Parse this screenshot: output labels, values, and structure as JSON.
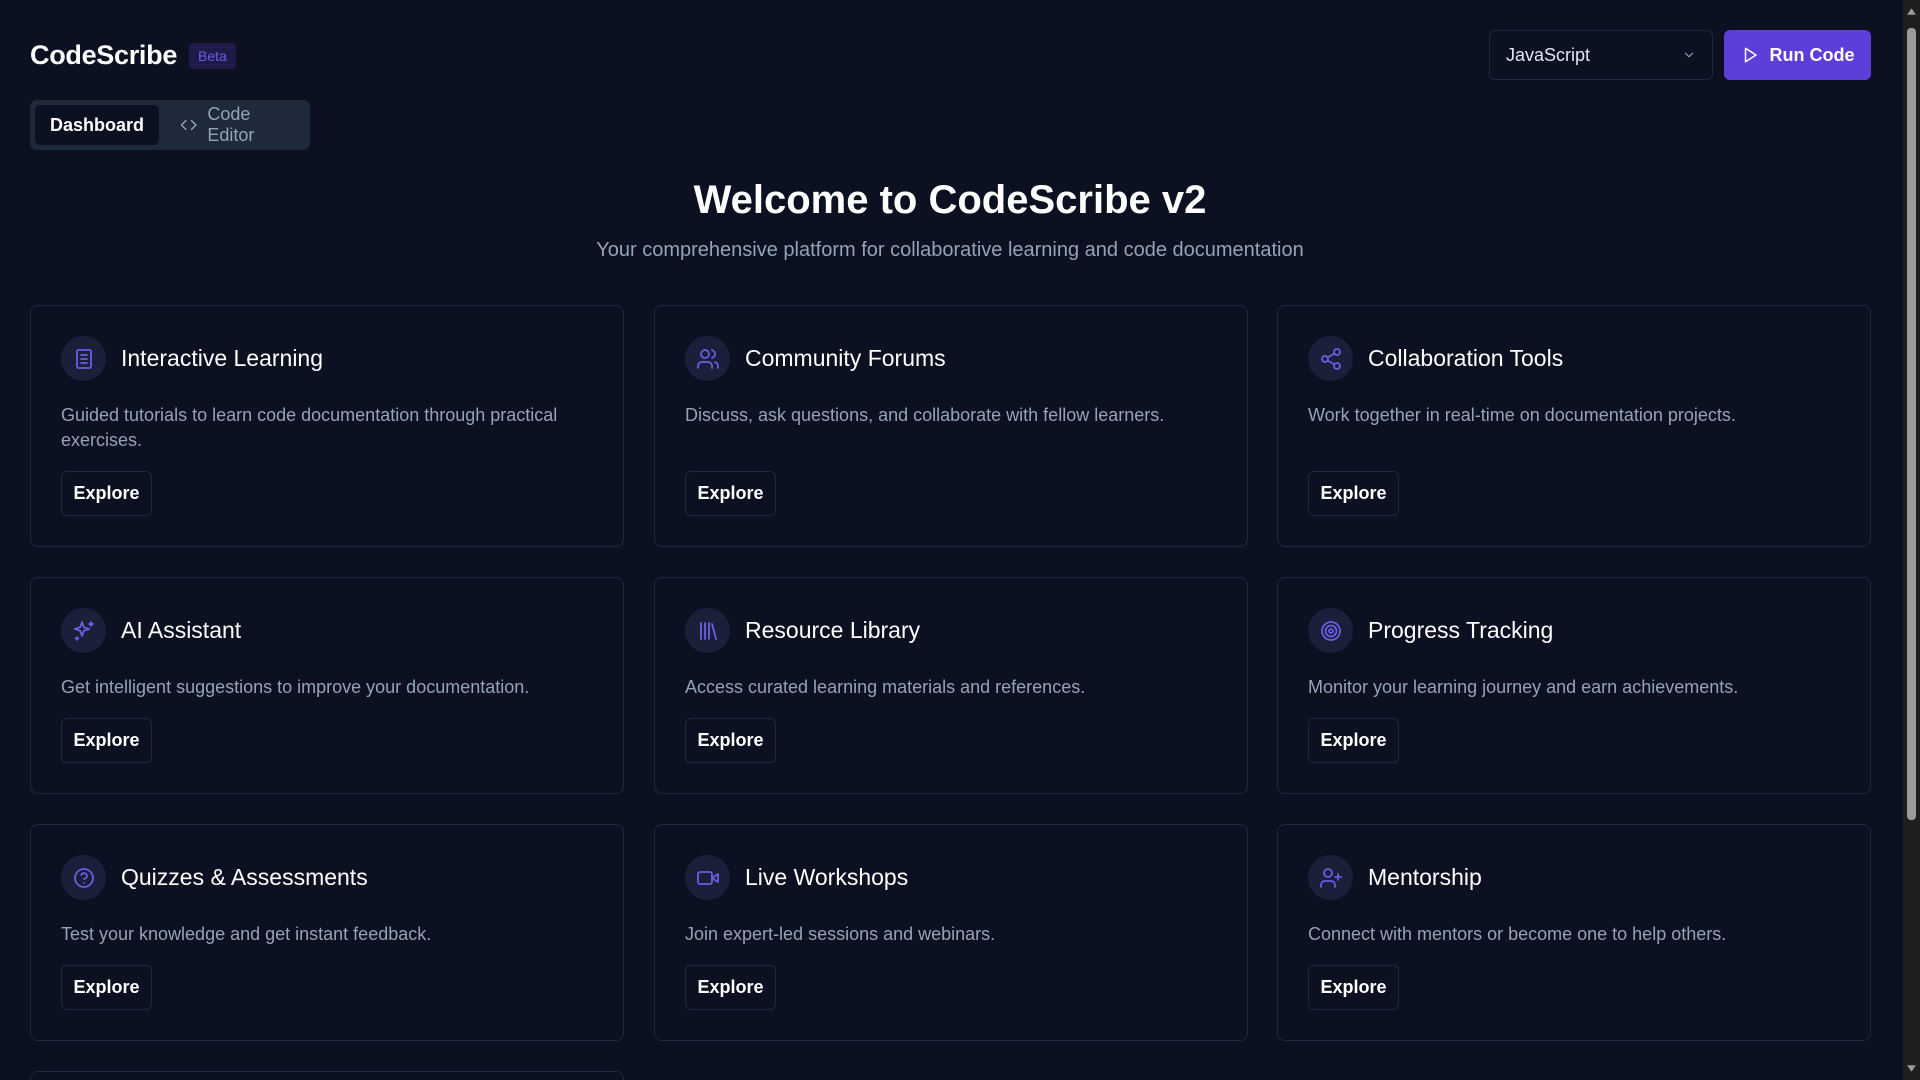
{
  "header": {
    "brand": "CodeScribe",
    "badge": "Beta",
    "language": "JavaScript",
    "run_label": "Run Code"
  },
  "tabs": [
    {
      "label": "Dashboard",
      "active": true
    },
    {
      "label": "Code Editor",
      "active": false,
      "icon": "code-icon"
    }
  ],
  "hero": {
    "title": "Welcome to CodeScribe v2",
    "subtitle": "Your comprehensive platform for collaborative learning and code documentation"
  },
  "cards": [
    {
      "title": "Interactive Learning",
      "icon": "book-icon",
      "description": "Guided tutorials to learn code documentation through practical exercises.",
      "button": "Explore"
    },
    {
      "title": "Community Forums",
      "icon": "users-icon",
      "description": "Discuss, ask questions, and collaborate with fellow learners.",
      "button": "Explore"
    },
    {
      "title": "Collaboration Tools",
      "icon": "share-icon",
      "description": "Work together in real-time on documentation projects.",
      "button": "Explore"
    },
    {
      "title": "AI Assistant",
      "icon": "sparkles-icon",
      "description": "Get intelligent suggestions to improve your documentation.",
      "button": "Explore"
    },
    {
      "title": "Resource Library",
      "icon": "library-icon",
      "description": "Access curated learning materials and references.",
      "button": "Explore"
    },
    {
      "title": "Progress Tracking",
      "icon": "target-icon",
      "description": "Monitor your learning journey and earn achievements.",
      "button": "Explore"
    },
    {
      "title": "Quizzes & Assessments",
      "icon": "help-circle-icon",
      "description": "Test your knowledge and get instant feedback.",
      "button": "Explore"
    },
    {
      "title": "Live Workshops",
      "icon": "video-icon",
      "description": "Join expert-led sessions and webinars.",
      "button": "Explore"
    },
    {
      "title": "Mentorship",
      "icon": "user-plus-icon",
      "description": "Connect with mentors or become one to help others.",
      "button": "Explore"
    }
  ],
  "colors": {
    "background": "#0b1120",
    "border": "#1e293b",
    "accent": "#5b3fd8",
    "icon": "#6d5ce6",
    "muted_text": "#94a3b8"
  }
}
